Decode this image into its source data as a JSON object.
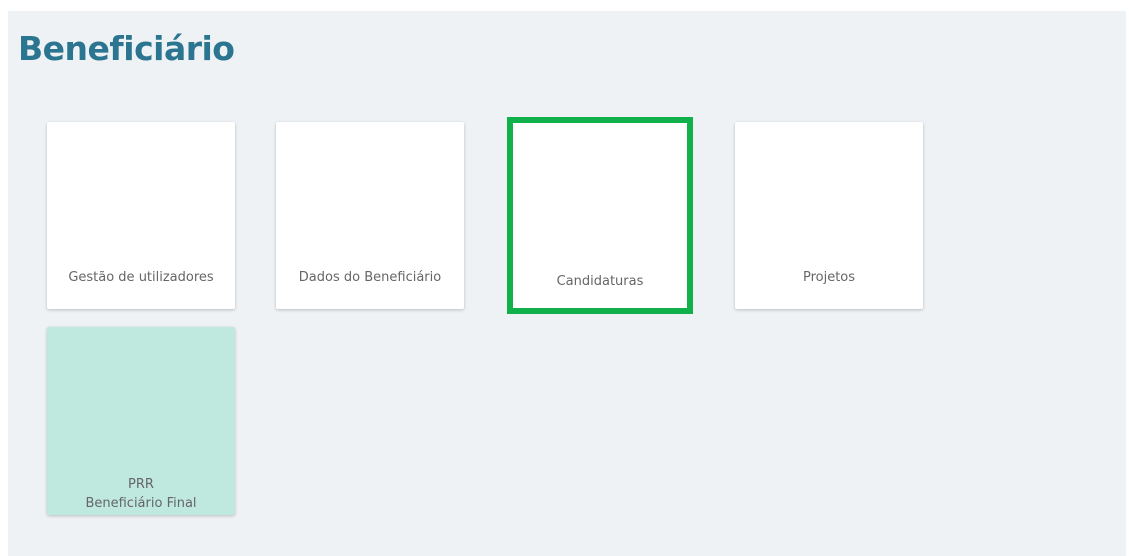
{
  "page": {
    "title": "Beneficiário"
  },
  "tiles": [
    {
      "label": "Gestão de utilizadores"
    },
    {
      "label": "Dados do Beneficiário"
    },
    {
      "label": "Candidaturas",
      "highlighted": true,
      "highlight_color": "#10b14b"
    },
    {
      "label": "Projetos"
    },
    {
      "label_line1": "PRR",
      "label_line2": "Beneficiário Final",
      "background": "#bfe8df"
    }
  ],
  "colors": {
    "title": "#2b7590",
    "panel_background": "#eef2f5"
  }
}
